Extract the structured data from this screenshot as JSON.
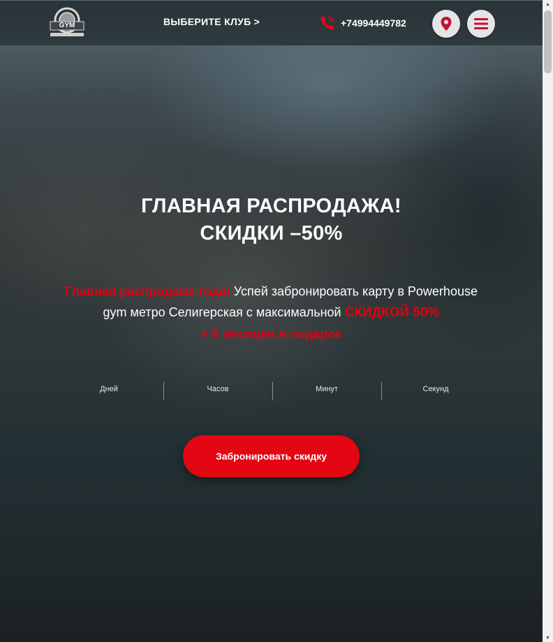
{
  "header": {
    "logo_label": "GYM",
    "club_select_label": "ВЫБЕРИТЕ КЛУБ >",
    "phone_number": "+74994449782",
    "phone_icon": "phone-icon",
    "location_icon": "map-pin-icon",
    "menu_icon": "hamburger-menu-icon"
  },
  "hero": {
    "title_line1": "ГЛАВНАЯ РАСПРОДАЖА!",
    "title_line2": "СКИДКИ –50%",
    "desc_red_lead": "Главная распродажа года!",
    "desc_text": " Успей забронировать карту в Powerhouse gym метро Селигерская с максимальной ",
    "desc_red_discount": "СКИДКОЙ 50%",
    "desc_red_tail": "+ 6 месяцев в подарок"
  },
  "countdown": {
    "labels": [
      "Дней",
      "Часов",
      "Минут",
      "Секунд"
    ]
  },
  "cta": {
    "label": "Забронировать скидку"
  },
  "colors": {
    "accent": "#e30613",
    "text_red": "#e3000f",
    "button_circle_bg": "#e3e5e6"
  }
}
